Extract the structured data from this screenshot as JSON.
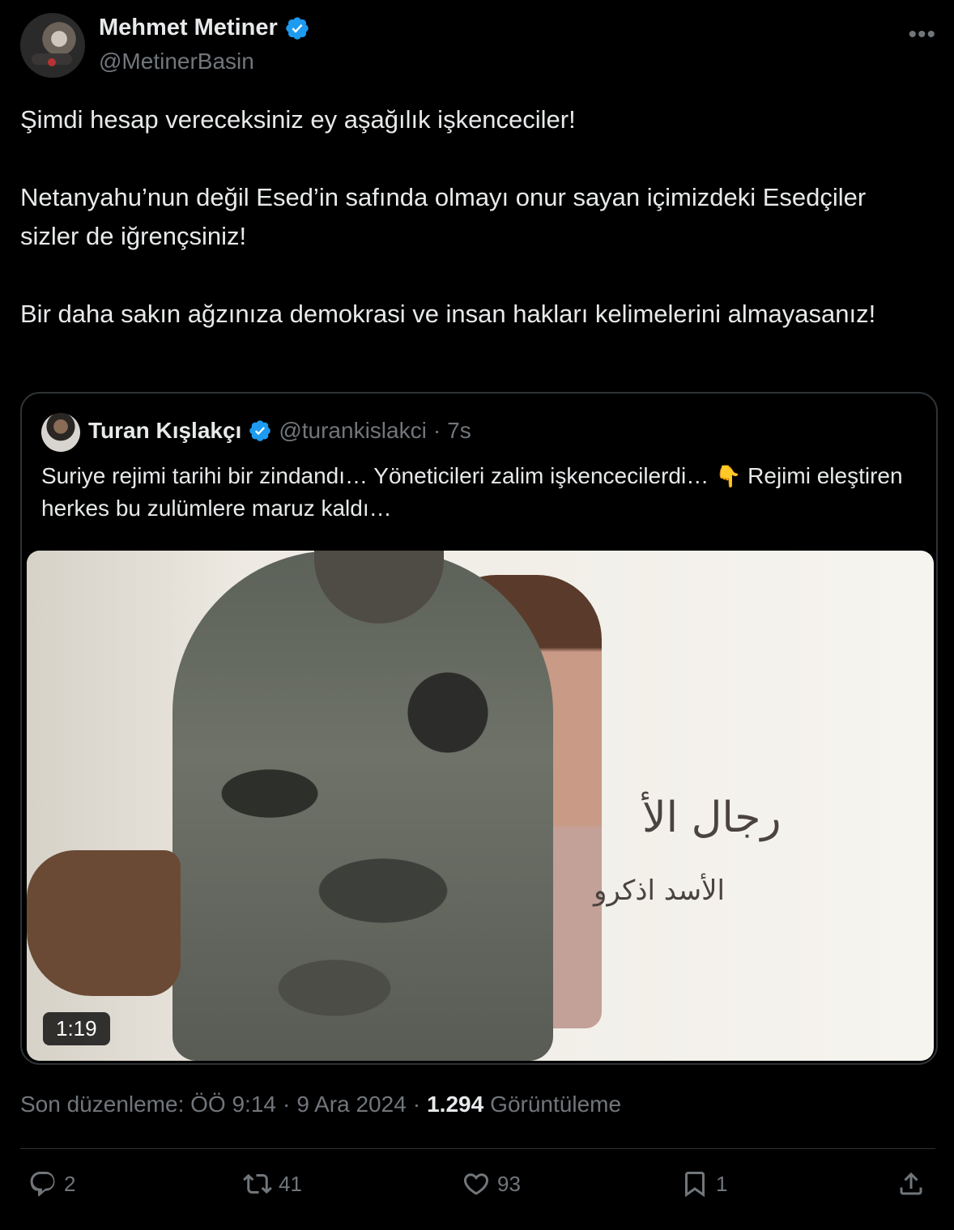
{
  "author": {
    "name": "Mehmet Metiner",
    "handle": "@MetinerBasin",
    "verified_color": "#1d9bf0"
  },
  "more_icon": "more-icon",
  "tweet": {
    "paragraph1": "Şimdi hesap vereceksiniz ey aşağılık işkenceciler!",
    "paragraph2": "Netanyahu’nun değil Esed’in safında olmayı onur sayan içimizdeki Esedçiler sizler de iğrençsiniz!",
    "paragraph3": "Bir daha sakın ağzınıza demokrasi ve insan hakları kelimelerini almayasanız!"
  },
  "quote": {
    "name": "Turan Kışlakçı",
    "handle": "@turankislakci",
    "separator": "·",
    "time": "7s",
    "text_part1": "Suriye rejimi tarihi bir zindandı… Yöneticileri zalim işkencecilerdi…",
    "emoji": "👇",
    "text_part2": "Rejimi eleştiren herkes bu zulümlere maruz kaldı…",
    "video_duration": "1:19",
    "wall_text_line1": "رجال الأ",
    "wall_text_line2": "الأسد اذكرو"
  },
  "meta": {
    "edited_label": "Son düzenleme: ÖÖ 9:14",
    "sep1": "·",
    "date": "9 Ara 2024",
    "sep2": "·",
    "views_count": "1.294",
    "views_label": "Görüntüleme"
  },
  "actions": {
    "replies": "2",
    "retweets": "41",
    "likes": "93",
    "bookmarks": "1"
  },
  "colors": {
    "background": "#000000",
    "text": "#e7e9ea",
    "secondary": "#71767b",
    "border": "#2f3336",
    "accent": "#1d9bf0"
  }
}
